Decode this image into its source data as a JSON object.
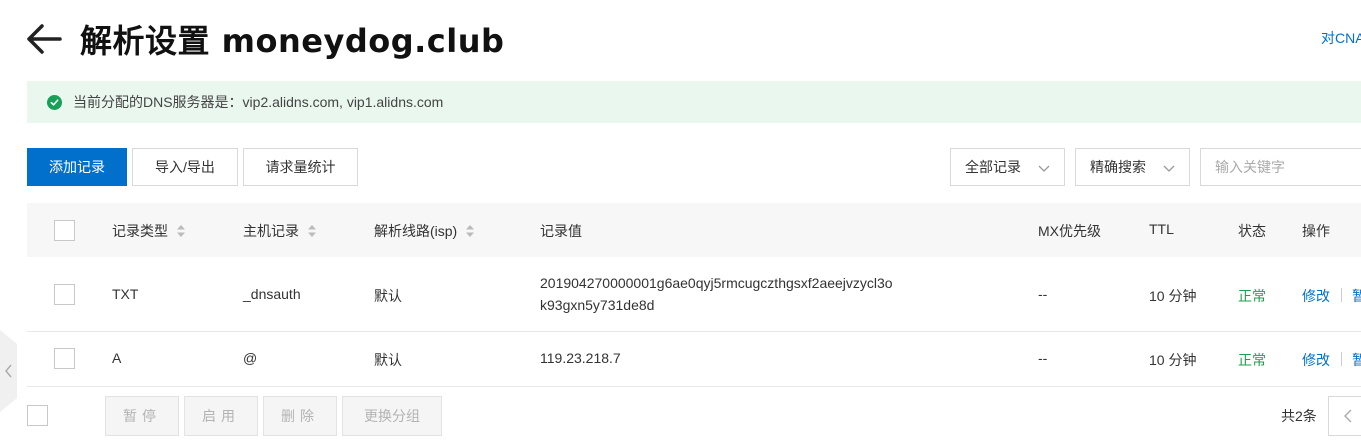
{
  "header": {
    "title": "解析设置 moneydog.club",
    "top_link": "对CNA"
  },
  "notice": {
    "text": "当前分配的DNS服务器是：vip2.alidns.com, vip1.alidns.com"
  },
  "toolbar": {
    "add_record": "添加记录",
    "import_export": "导入/导出",
    "request_stats": "请求量统计",
    "record_filter": "全部记录",
    "search_mode": "精确搜索",
    "search_placeholder": "输入关键字"
  },
  "table": {
    "columns": {
      "type": "记录类型",
      "host": "主机记录",
      "line": "解析线路(isp)",
      "value": "记录值",
      "mx": "MX优先级",
      "ttl": "TTL",
      "status": "状态",
      "actions": "操作"
    },
    "rows": [
      {
        "type": "TXT",
        "host": "_dnsauth",
        "line": "默认",
        "value_line1": "201904270000001g6ae0qyj5rmcugczthgsxf2aeejvzycl3o",
        "value_line2": "k93gxn5y731de8d",
        "mx": "--",
        "ttl": "10 分钟",
        "status": "正常",
        "edit": "修改",
        "more": "暂"
      },
      {
        "type": "A",
        "host": "@",
        "line": "默认",
        "value_line1": "119.23.218.7",
        "mx": "--",
        "ttl": "10 分钟",
        "status": "正常",
        "edit": "修改",
        "more": "暂"
      }
    ]
  },
  "footer": {
    "pause": "暂停",
    "enable": "启用",
    "delete": "删除",
    "change_group": "更换分组",
    "total": "共2条"
  },
  "colors": {
    "primary": "#0070cc",
    "success": "#1e9f4b",
    "notice_bg": "#eaf7ee"
  }
}
